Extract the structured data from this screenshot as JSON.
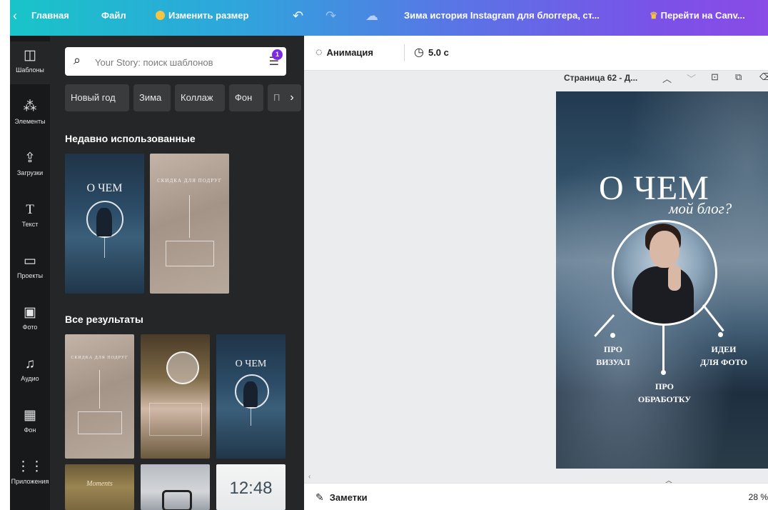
{
  "topbar": {
    "back_glyph": "‹",
    "home": "Главная",
    "file": "Файл",
    "resize": "Изменить размер",
    "undo_glyph": "↶",
    "redo_glyph": "↷",
    "cloud_glyph": "☁",
    "doc_title": "Зима история Instagram для блоггера, ст...",
    "upgrade": "Перейти на Canv..."
  },
  "rail": {
    "items": [
      {
        "icon": "◫",
        "label": "Шаблоны"
      },
      {
        "icon": "⁂",
        "label": "Элементы"
      },
      {
        "icon": "⇪",
        "label": "Загрузки"
      },
      {
        "icon": "T",
        "label": "Текст"
      },
      {
        "icon": "▭",
        "label": "Проекты"
      },
      {
        "icon": "▣",
        "label": "Фото"
      },
      {
        "icon": "♫",
        "label": "Аудио"
      },
      {
        "icon": "▦",
        "label": "Фон"
      },
      {
        "icon": "⋮⋮",
        "label": "Приложения"
      }
    ]
  },
  "panel": {
    "search_placeholder": "Your Story: поиск шаблонов",
    "filter_badge": "1",
    "chips": [
      "Новый год",
      "Зима",
      "Коллаж",
      "Фон",
      "П"
    ],
    "recent_title": "Недавно использованные",
    "all_title": "Все результаты",
    "thumbs": {
      "title_short": "О ЧЕМ",
      "sale_text": "СКИДКА ДЛЯ ПОДРУГ",
      "clock": "12:48",
      "script_word": "Moments"
    }
  },
  "editor": {
    "animation": "Анимация",
    "duration": "5.0 с",
    "page_title": "Страница 62 - Д...",
    "canvas": {
      "title": "О ЧЕМ",
      "script": "мой блог?",
      "label_left": [
        "ПРО",
        "ВИЗУАЛ"
      ],
      "label_center": [
        "ПРО",
        "ОБРАБОТКУ"
      ],
      "label_right": [
        "ИДЕИ",
        "ДЛЯ ФОТО"
      ]
    },
    "notes": "Заметки",
    "zoom": "28 %"
  }
}
